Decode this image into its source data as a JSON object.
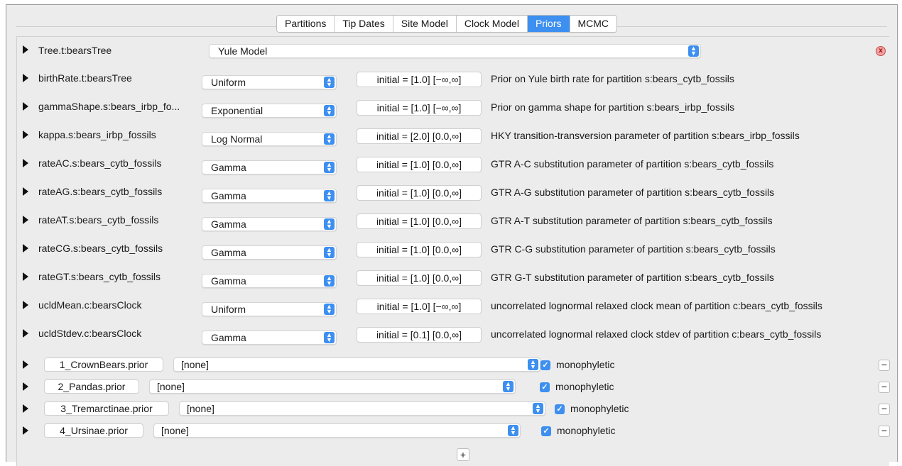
{
  "tabs": [
    {
      "label": "Partitions",
      "active": false
    },
    {
      "label": "Tip Dates",
      "active": false
    },
    {
      "label": "Site Model",
      "active": false
    },
    {
      "label": "Clock Model",
      "active": false
    },
    {
      "label": "Priors",
      "active": true
    },
    {
      "label": "MCMC",
      "active": false
    }
  ],
  "tree_prior": {
    "label": "Tree.t:bearsTree",
    "model": "Yule Model"
  },
  "priors": [
    {
      "label": "birthRate.t:bearsTree",
      "dist": "Uniform",
      "initial": "initial = [1.0] [−∞,∞]",
      "desc": "Prior on Yule birth rate for partition s:bears_cytb_fossils"
    },
    {
      "label": "gammaShape.s:bears_irbp_fo...",
      "dist": "Exponential",
      "initial": "initial = [1.0] [−∞,∞]",
      "desc": "Prior on gamma shape for partition s:bears_irbp_fossils"
    },
    {
      "label": "kappa.s:bears_irbp_fossils",
      "dist": "Log Normal",
      "initial": "initial = [2.0] [0.0,∞]",
      "desc": "HKY transition-transversion parameter of partition s:bears_irbp_fossils"
    },
    {
      "label": "rateAC.s:bears_cytb_fossils",
      "dist": "Gamma",
      "initial": "initial = [1.0] [0.0,∞]",
      "desc": "GTR A-C substitution parameter of partition s:bears_cytb_fossils"
    },
    {
      "label": "rateAG.s:bears_cytb_fossils",
      "dist": "Gamma",
      "initial": "initial = [1.0] [0.0,∞]",
      "desc": "GTR A-G substitution parameter of partition s:bears_cytb_fossils"
    },
    {
      "label": "rateAT.s:bears_cytb_fossils",
      "dist": "Gamma",
      "initial": "initial = [1.0] [0.0,∞]",
      "desc": "GTR A-T substitution parameter of partition s:bears_cytb_fossils"
    },
    {
      "label": "rateCG.s:bears_cytb_fossils",
      "dist": "Gamma",
      "initial": "initial = [1.0] [0.0,∞]",
      "desc": "GTR C-G substitution parameter of partition s:bears_cytb_fossils"
    },
    {
      "label": "rateGT.s:bears_cytb_fossils",
      "dist": "Gamma",
      "initial": "initial = [1.0] [0.0,∞]",
      "desc": "GTR G-T substitution parameter of partition s:bears_cytb_fossils"
    },
    {
      "label": "ucldMean.c:bearsClock",
      "dist": "Uniform",
      "initial": "initial = [1.0] [−∞,∞]",
      "desc": "uncorrelated lognormal relaxed clock mean of partition c:bears_cytb_fossils"
    },
    {
      "label": "ucldStdev.c:bearsClock",
      "dist": "Gamma",
      "initial": "initial = [0.1] [0.0,∞]",
      "desc": "uncorrelated lognormal relaxed clock stdev of partition c:bears_cytb_fossils"
    }
  ],
  "taxon_priors": [
    {
      "name": "1_CrownBears.prior",
      "value": "[none]",
      "check_label": "monophyletic",
      "checked": true
    },
    {
      "name": "2_Pandas.prior",
      "value": "[none]",
      "check_label": "monophyletic",
      "checked": true
    },
    {
      "name": "3_Tremarctinae.prior",
      "value": "[none]",
      "check_label": "monophyletic",
      "checked": true
    },
    {
      "name": "4_Ursinae.prior",
      "value": "[none]",
      "check_label": "monophyletic",
      "checked": true
    }
  ],
  "buttons": {
    "add": "+",
    "remove": "−",
    "close": "x"
  },
  "icons": {
    "expand": "triangle-right-icon",
    "combo": "up-down-arrows-icon",
    "check": "checkmark-icon"
  },
  "colors": {
    "accent": "#3d8ff0",
    "panel": "#ececec",
    "close": "#f1a2a2"
  }
}
